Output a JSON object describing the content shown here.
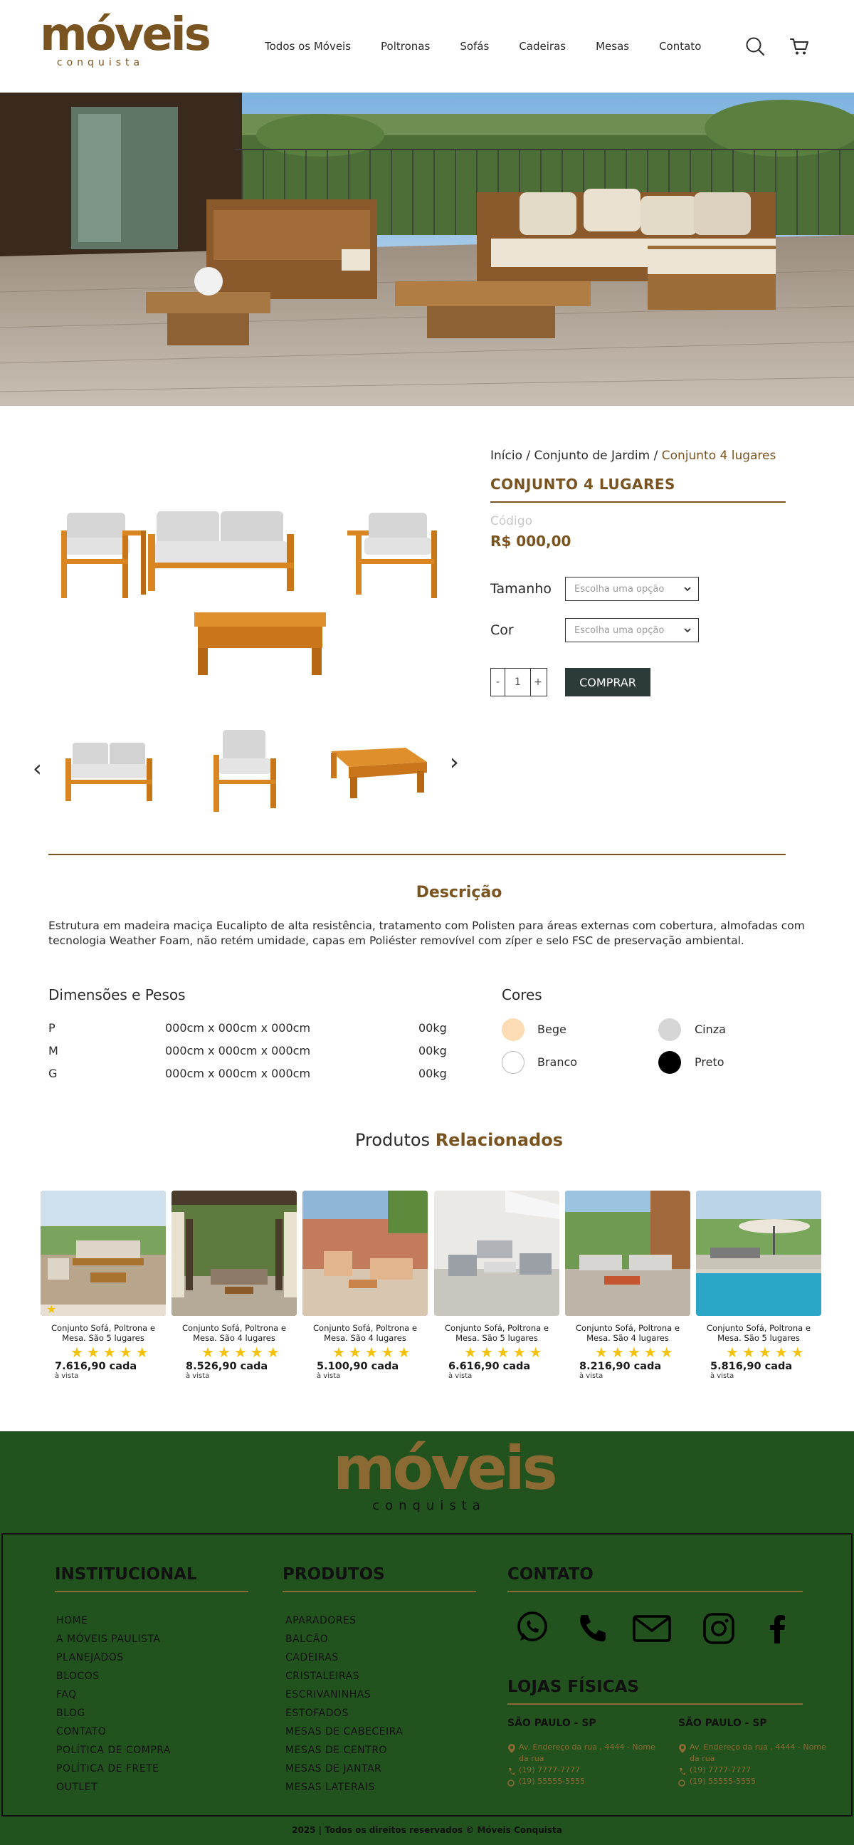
{
  "header": {
    "logo_text": "móveis",
    "logo_sub": "conquista",
    "nav": [
      "Todos os Móveis",
      "Poltronas",
      "Sofás",
      "Cadeiras",
      "Mesas",
      "Contato"
    ]
  },
  "breadcrumb": {
    "home": "Início",
    "category": "Conjunto de Jardim",
    "current": "Conjunto 4 lugares",
    "sep": " / "
  },
  "product": {
    "title": "CONJUNTO 4 LUGARES",
    "code_label": "Código",
    "price": "R$ 000,00",
    "size_label": "Tamanho",
    "color_label": "Cor",
    "select_placeholder": "Escolha uma opção",
    "qty_minus": "-",
    "qty_value": "1",
    "qty_plus": "+",
    "buy_label": "COMPRAR",
    "prev_arrow": "‹",
    "next_arrow": "›"
  },
  "description": {
    "title": "Descrição",
    "text": "Estrutura em madeira maciça Eucalipto de alta resistência, tratamento com Polisten para áreas externas com cobertura, almofadas com tecnologia Weather Foam, não retém umidade, capas em Poliéster removível com zíper e selo FSC de preservação ambiental."
  },
  "dimensions": {
    "title": "Dimensões e Pesos",
    "rows": [
      {
        "size": "P",
        "dims": "000cm x 000cm x 000cm",
        "weight": "00kg"
      },
      {
        "size": "M",
        "dims": "000cm x 000cm x 000cm",
        "weight": "00kg"
      },
      {
        "size": "G",
        "dims": "000cm x 000cm x 000cm",
        "weight": "00kg"
      }
    ]
  },
  "colors": {
    "title": "Cores",
    "items": [
      {
        "name": "Bege",
        "hex": "#fcdcb4"
      },
      {
        "name": "Cinza",
        "hex": "#d6d6d6"
      },
      {
        "name": "Branco",
        "hex": "#ffffff"
      },
      {
        "name": "Preto",
        "hex": "#000000"
      }
    ]
  },
  "related": {
    "title_a": "Produtos ",
    "title_b": "Relacionados",
    "cards": [
      {
        "name": "Conjunto Sofá, Poltrona e Mesa. São 5 lugares",
        "price": "7.616,90 cada",
        "note": "à vista",
        "rating": 5
      },
      {
        "name": "Conjunto Sofá, Poltrona e Mesa. São 4 lugares",
        "price": "8.526,90 cada",
        "note": "à vista",
        "rating": 5
      },
      {
        "name": "Conjunto Sofá, Poltrona e Mesa. São 4 lugares",
        "price": "5.100,90 cada",
        "note": "à vista",
        "rating": 5
      },
      {
        "name": "Conjunto Sofá, Poltrona e Mesa. São 5 lugares",
        "price": "6.616,90 cada",
        "note": "à vista",
        "rating": 5
      },
      {
        "name": "Conjunto Sofá, Poltrona e Mesa. São 4 lugares",
        "price": "8.216,90 cada",
        "note": "à vista",
        "rating": 5
      },
      {
        "name": "Conjunto Sofá, Poltrona e Mesa. São 5 lugares",
        "price": "5.816,90 cada",
        "note": "à vista",
        "rating": 5
      }
    ]
  },
  "footer": {
    "logo_text": "móveis",
    "logo_sub": "conquista",
    "institucional_title": "INSTITUCIONAL",
    "institucional": [
      "HOME",
      "A MÓVEIS PAULISTA",
      "PLANEJADOS",
      "BLOCOS",
      "FAQ",
      "BLOG",
      "CONTATO",
      "POLÍTICA DE COMPRA",
      "POLÍTICA DE FRETE",
      "OUTLET"
    ],
    "produtos_title": "PRODUTOS",
    "produtos": [
      "APARADORES",
      "BALCÃO",
      "CADEIRAS",
      "CRISTALEIRAS",
      "ESCRIVANINHAS",
      "ESTOFADOS",
      "MESAS DE CABECEIRA",
      "MESAS DE CENTRO",
      "MESAS DE JANTAR",
      "MESAS LATERAIS"
    ],
    "contato_title": "CONTATO",
    "lojas_title": "LOJAS FÍSICAS",
    "stores": [
      {
        "city": "SÃO PAULO - SP",
        "address": "Av. Endereço da rua , 4444 - Nome da rua",
        "phone1": "(19) 7777-7777",
        "phone2": "(19) 55555-5555"
      },
      {
        "city": "SÃO PAULO - SP",
        "address": "Av. Endereço da rua , 4444 - Nome da rua",
        "phone1": "(19) 7777-7777",
        "phone2": "(19) 55555-5555"
      }
    ],
    "copyright": "2025 | Todos os direitos reservados © Móveis Conquista"
  }
}
